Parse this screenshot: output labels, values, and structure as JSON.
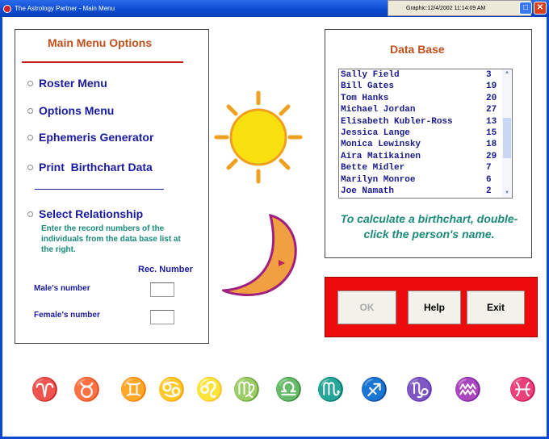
{
  "window": {
    "title": "The Astrology Partner - Main Menu",
    "tray_text": "Graphic:12/4/2002 11:14:09 AM"
  },
  "menu": {
    "heading": "Main Menu Options",
    "options": [
      "Roster Menu",
      "Options Menu",
      "Ephemeris Generator",
      "Print  Birthchart Data"
    ],
    "relationship": "Select Relationship",
    "hint": "Enter the record numbers of the individuals  from the data base list at the right.",
    "rec_header": "Rec. Number",
    "male_label": "Male's number",
    "female_label": "Female's number",
    "male_value": "",
    "female_value": ""
  },
  "database": {
    "heading": "Data Base",
    "rows": [
      {
        "name": "Sally Field",
        "num": "3"
      },
      {
        "name": "Bill Gates",
        "num": "19"
      },
      {
        "name": "Tom Hanks",
        "num": "20"
      },
      {
        "name": "Michael Jordan",
        "num": "27"
      },
      {
        "name": "Elisabeth Kubler-Ross",
        "num": "13"
      },
      {
        "name": "Jessica Lange",
        "num": "15"
      },
      {
        "name": "Monica Lewinsky",
        "num": "18"
      },
      {
        "name": "Aira Matikainen",
        "num": "29"
      },
      {
        "name": "Bette Midler",
        "num": "7"
      },
      {
        "name": "Marilyn Monroe",
        "num": "6"
      },
      {
        "name": "Joe Namath",
        "num": "2"
      }
    ],
    "hint": "To calculate a birthchart, double-click the person's name."
  },
  "buttons": {
    "ok": "OK",
    "help": "Help",
    "exit": "Exit"
  },
  "zodiac": [
    {
      "name": "aries",
      "glyph": "♈",
      "color": "#2a6ac8"
    },
    {
      "name": "taurus",
      "glyph": "♉",
      "color": "#e0a020"
    },
    {
      "name": "gemini",
      "glyph": "♊",
      "color": "#d8c020"
    },
    {
      "name": "cancer",
      "glyph": "♋",
      "color": "#5a2a7a"
    },
    {
      "name": "leo",
      "glyph": "♌",
      "color": "#c02060"
    },
    {
      "name": "virgo",
      "glyph": "♍",
      "color": "#d040a0"
    },
    {
      "name": "libra",
      "glyph": "♎",
      "color": "#2a6ac8"
    },
    {
      "name": "scorpio",
      "glyph": "♏",
      "color": "#d04020"
    },
    {
      "name": "sagittarius",
      "glyph": "♐",
      "color": "#111111"
    },
    {
      "name": "capricorn",
      "glyph": "♑",
      "color": "#111111"
    },
    {
      "name": "aquarius",
      "glyph": "♒",
      "color": "#6a3a9a"
    },
    {
      "name": "pisces",
      "glyph": "♓",
      "color": "#2a8a3a"
    }
  ]
}
